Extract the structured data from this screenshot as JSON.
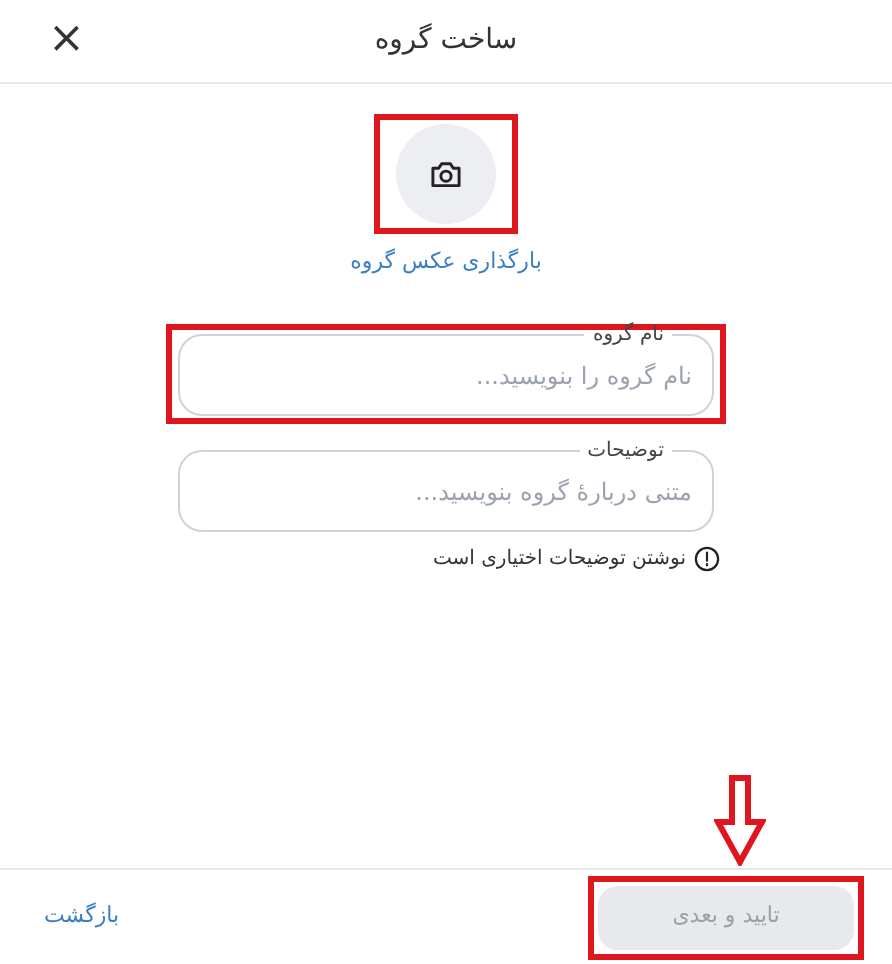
{
  "dialog": {
    "title": "ساخت گروه",
    "close_label": "×"
  },
  "photo_upload": {
    "highlighted": true,
    "link": "بارگذاری عکس گروه"
  },
  "fields": [
    {
      "label": "نام گروه",
      "placeholder": "نام گروه را بنویسید...",
      "highlighted": true
    },
    {
      "label": "توضیحات",
      "placeholder": "متنی دربارهٔ گروه بنویسید..."
    }
  ],
  "note": "نوشتن توضیحات اختیاری است",
  "footer": {
    "back": "بازگشت",
    "confirm": {
      "label": "تایید و بعدی",
      "disabled": true,
      "highlighted": true,
      "arrow": true
    }
  }
}
